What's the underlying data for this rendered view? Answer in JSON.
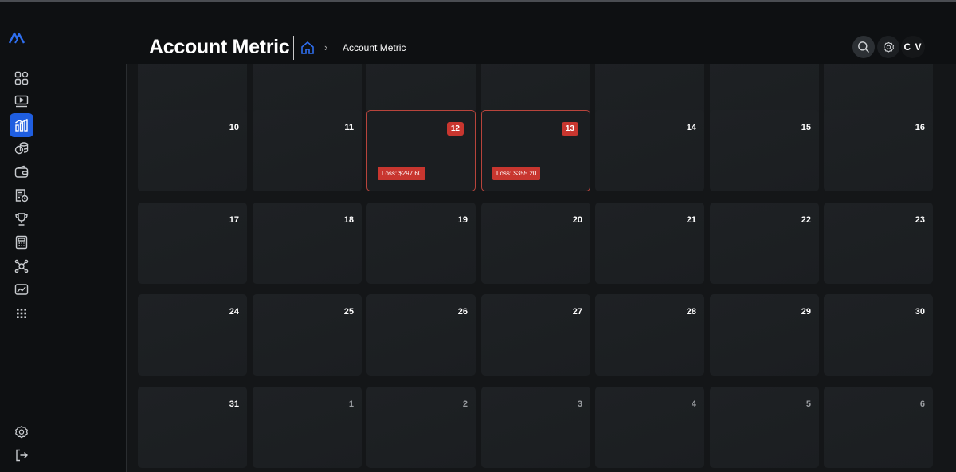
{
  "header": {
    "title": "Account Metric",
    "breadcrumb_separator": "›",
    "breadcrumb_current": "Account Metric",
    "avatar_initials": "C V"
  },
  "sidebar": {
    "items": [
      {
        "name": "dashboard-grid-icon",
        "active": false
      },
      {
        "name": "video-player-icon",
        "active": false
      },
      {
        "name": "account-metric-icon",
        "active": true
      },
      {
        "name": "coins-icon",
        "active": false
      },
      {
        "name": "wallet-icon",
        "active": false
      },
      {
        "name": "report-clock-icon",
        "active": false
      },
      {
        "name": "trophy-icon",
        "active": false
      },
      {
        "name": "calculator-icon",
        "active": false
      },
      {
        "name": "network-icon",
        "active": false
      },
      {
        "name": "chart-card-icon",
        "active": false
      },
      {
        "name": "apps-grid-icon",
        "active": false
      }
    ],
    "bottom_items": [
      {
        "name": "settings-icon"
      },
      {
        "name": "logout-icon"
      }
    ]
  },
  "calendar": {
    "rows": [
      [
        {
          "day": "",
          "muted": false
        },
        {
          "day": "",
          "muted": false
        },
        {
          "day": "",
          "muted": false
        },
        {
          "day": "",
          "muted": false
        },
        {
          "day": "",
          "muted": false
        },
        {
          "day": "",
          "muted": false
        },
        {
          "day": "",
          "muted": false
        }
      ],
      [
        {
          "day": "10",
          "muted": false
        },
        {
          "day": "11",
          "muted": false
        },
        {
          "day": "12",
          "muted": false,
          "loss": "Loss: $297.60"
        },
        {
          "day": "13",
          "muted": false,
          "loss": "Loss: $355.20"
        },
        {
          "day": "14",
          "muted": false
        },
        {
          "day": "15",
          "muted": false
        },
        {
          "day": "16",
          "muted": false
        }
      ],
      [
        {
          "day": "17",
          "muted": false
        },
        {
          "day": "18",
          "muted": false
        },
        {
          "day": "19",
          "muted": false
        },
        {
          "day": "20",
          "muted": false
        },
        {
          "day": "21",
          "muted": false
        },
        {
          "day": "22",
          "muted": false
        },
        {
          "day": "23",
          "muted": false
        }
      ],
      [
        {
          "day": "24",
          "muted": false
        },
        {
          "day": "25",
          "muted": false
        },
        {
          "day": "26",
          "muted": false
        },
        {
          "day": "27",
          "muted": false
        },
        {
          "day": "28",
          "muted": false
        },
        {
          "day": "29",
          "muted": false
        },
        {
          "day": "30",
          "muted": false
        }
      ],
      [
        {
          "day": "31",
          "muted": false
        },
        {
          "day": "1",
          "muted": true
        },
        {
          "day": "2",
          "muted": true
        },
        {
          "day": "3",
          "muted": true
        },
        {
          "day": "4",
          "muted": true
        },
        {
          "day": "5",
          "muted": true
        },
        {
          "day": "6",
          "muted": true
        }
      ]
    ]
  },
  "colors": {
    "accent": "#1f5ee0",
    "loss": "#c8362f"
  }
}
